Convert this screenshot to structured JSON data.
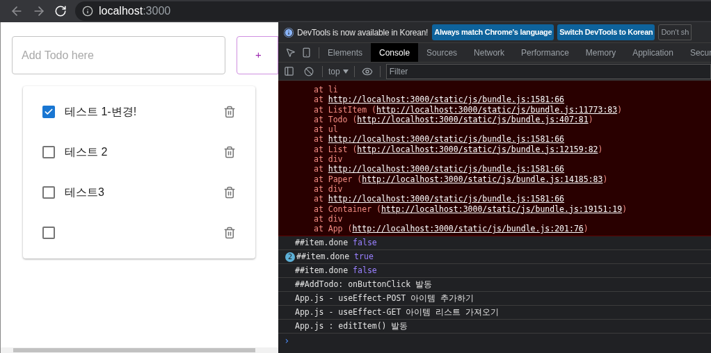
{
  "browser": {
    "host": "localhost",
    "port": ":3000"
  },
  "todo": {
    "input": {
      "placeholder": "Add Todo here"
    },
    "add_button": "+",
    "items": [
      {
        "text": "테스트 1-변경!",
        "checked": true
      },
      {
        "text": "테스트 2",
        "checked": false
      },
      {
        "text": "테스트3",
        "checked": false
      },
      {
        "checked": false
      }
    ]
  },
  "devtools": {
    "infobar": {
      "message": "DevTools is now available in Korean!",
      "buttons": [
        "Always match Chrome's language",
        "Switch DevTools to Korean",
        "Don't sh"
      ]
    },
    "tabs": [
      {
        "label": "Elements",
        "selected": false
      },
      {
        "label": "Console",
        "selected": true
      },
      {
        "label": "Sources",
        "selected": false
      },
      {
        "label": "Network",
        "selected": false
      },
      {
        "label": "Performance",
        "selected": false
      },
      {
        "label": "Memory",
        "selected": false
      },
      {
        "label": "Application",
        "selected": false
      },
      {
        "label": "Secur",
        "selected": false
      }
    ],
    "toolbar": {
      "context": "top",
      "filter": {
        "placeholder": "Filter"
      }
    },
    "error_stack": [
      {
        "text": "at li"
      },
      {
        "text": "at ",
        "link": "http://localhost:3000/static/js/bundle.js:1581:66"
      },
      {
        "text": "at ListItem (",
        "link": "http://localhost:3000/static/js/bundle.js:11773:83",
        "tail": ")"
      },
      {
        "text": "at Todo (",
        "link": "http://localhost:3000/static/js/bundle.js:407:81",
        "tail": ")"
      },
      {
        "text": "at ul"
      },
      {
        "text": "at ",
        "link": "http://localhost:3000/static/js/bundle.js:1581:66"
      },
      {
        "text": "at List (",
        "link": "http://localhost:3000/static/js/bundle.js:12159:82",
        "tail": ")"
      },
      {
        "text": "at div"
      },
      {
        "text": "at ",
        "link": "http://localhost:3000/static/js/bundle.js:1581:66"
      },
      {
        "text": "at Paper (",
        "link": "http://localhost:3000/static/js/bundle.js:14185:83",
        "tail": ")"
      },
      {
        "text": "at div"
      },
      {
        "text": "at ",
        "link": "http://localhost:3000/static/js/bundle.js:1581:66"
      },
      {
        "text": "at Container (",
        "link": "http://localhost:3000/static/js/bundle.js:19151:19",
        "tail": ")"
      },
      {
        "text": "at div"
      },
      {
        "text": "at App (",
        "link": "http://localhost:3000/static/js/bundle.js:201:76",
        "tail": ")"
      }
    ],
    "logs": [
      {
        "text": "##item.done",
        "value": "false"
      },
      {
        "text": "##item.done",
        "value": "true",
        "count": "2"
      },
      {
        "text": "##item.done",
        "value": "false"
      },
      {
        "text": "##AddTodo: onButtonClick 발동"
      },
      {
        "text": "App.js - useEffect-POST 아이템 추가하기"
      },
      {
        "text": "App.js - useEffect-GET 아이템 리스트 가져오기"
      },
      {
        "text": "App.js : editItem() 발동"
      }
    ],
    "prompt": "›"
  }
}
